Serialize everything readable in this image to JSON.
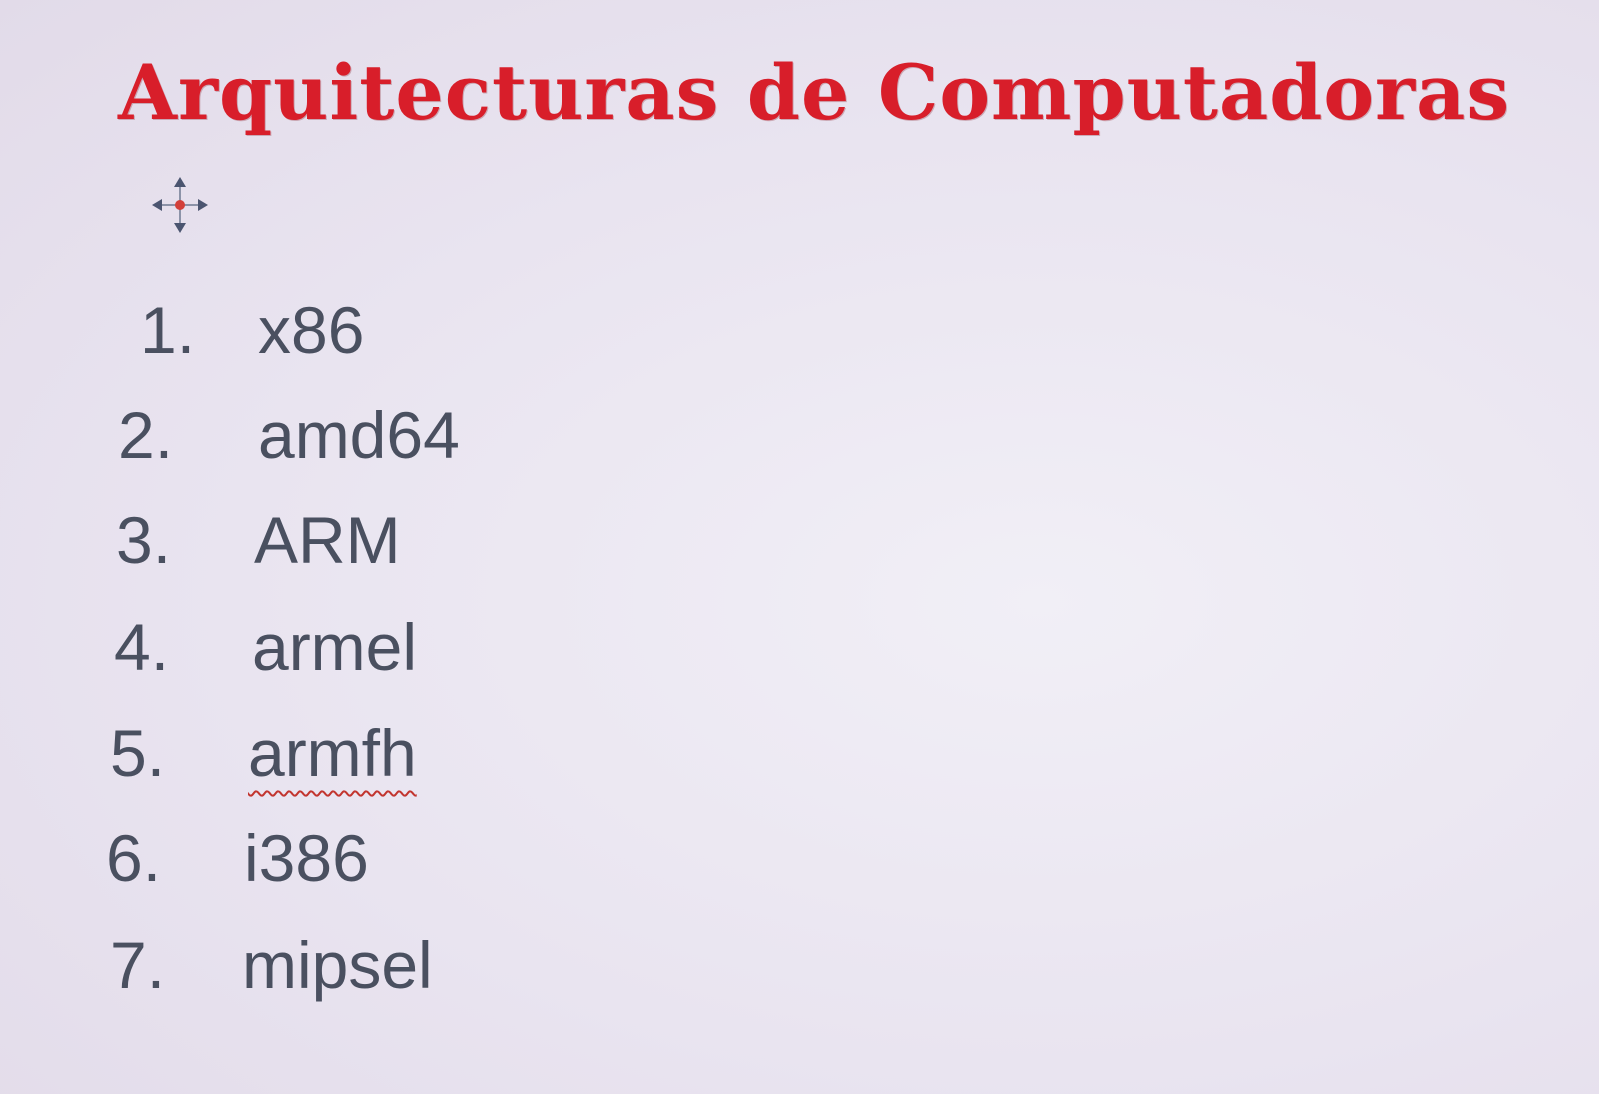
{
  "slide": {
    "title": "Arquitecturas de Computadoras",
    "title_color": "#d81e2a",
    "text_color": "#4a5060",
    "move_handle_icon": "move-arrows-icon",
    "items": [
      {
        "number": "1.",
        "label": "x86"
      },
      {
        "number": "2.",
        "label": "amd64"
      },
      {
        "number": "3.",
        "label": "ARM"
      },
      {
        "number": "4.",
        "label": "armel"
      },
      {
        "number": "5.",
        "label": "armfh",
        "spellcheck_flag": true
      },
      {
        "number": "6.",
        "label": "i386"
      },
      {
        "number": "7.",
        "label": "mipsel"
      }
    ]
  }
}
